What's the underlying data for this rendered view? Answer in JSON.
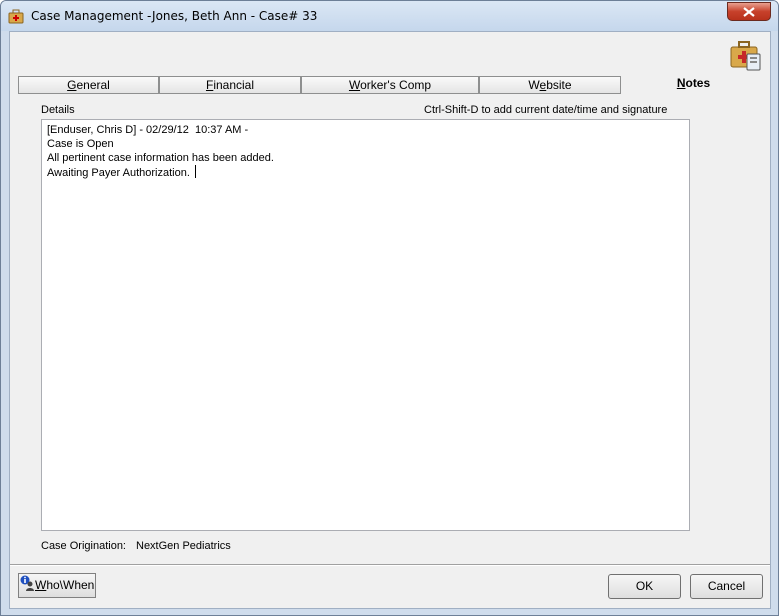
{
  "window": {
    "title": "Case Management -Jones, Beth Ann - Case#  33",
    "close_symbol": "✕"
  },
  "tabs": [
    {
      "label": "General",
      "accel": "G",
      "rest": "eneral"
    },
    {
      "label": "Financial",
      "accel": "F",
      "rest": "inancial"
    },
    {
      "label": "Worker's Comp",
      "accel": "W",
      "rest": "orker's Comp"
    },
    {
      "label": "Website",
      "pre": "W",
      "accel": "e",
      "rest": "bsite"
    },
    {
      "label": "Notes",
      "accel": "N",
      "rest": "otes"
    }
  ],
  "notes": {
    "details_label": "Details",
    "hint": "Ctrl-Shift-D to add current date/time and signature",
    "lines": [
      "[Enduser, Chris D] - 02/29/12  10:37 AM -",
      "Case is Open",
      "All pertinent case information has been added.",
      "Awaiting Payer Authorization. "
    ]
  },
  "origination": {
    "label": "Case Origination:",
    "value": "NextGen Pediatrics"
  },
  "buttons": {
    "whowhen_pre": "W",
    "whowhen_rest": "ho\\When",
    "ok": "OK",
    "cancel": "Cancel"
  },
  "icons": {
    "title": "case-management-icon",
    "header": "medical-case-icon",
    "close": "close-icon",
    "whowhen": "info-person-icon"
  },
  "colors": {
    "titlebar": "#c5d7ec",
    "close_button": "#c7412b",
    "dialog_bg": "#f0f0f0"
  }
}
